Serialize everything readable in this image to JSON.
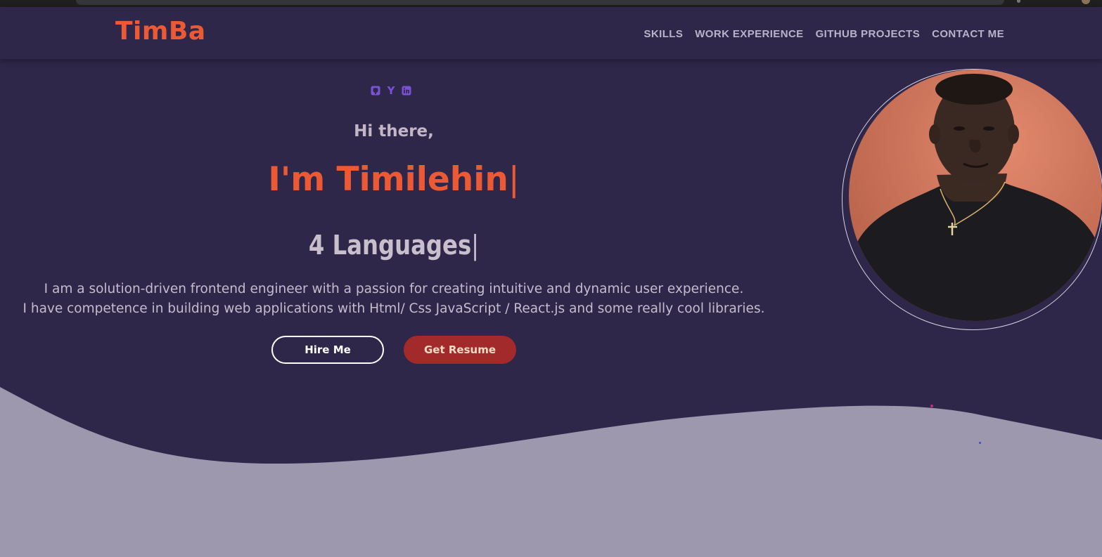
{
  "brand": "TimBa",
  "nav": {
    "items": [
      "SKILLS",
      "WORK EXPERIENCE",
      "GITHUB PROJECTS",
      "CONTACT ME"
    ]
  },
  "socials": [
    {
      "icon": "github-icon"
    },
    {
      "icon": "ycombinator-icon",
      "glyph": "Y"
    },
    {
      "icon": "linkedin-icon"
    }
  ],
  "hero": {
    "greeting": "Hi there,",
    "name": "I'm Timilehin",
    "typed": "4 Languages",
    "cursor": "|",
    "intro_line1": "I am a solution-driven frontend engineer with a passion for creating intuitive and dynamic user experience.",
    "intro_line2": "I have competence in building web applications with Html/ Css JavaScript / React.js and some really cool libraries."
  },
  "buttons": {
    "hire": "Hire Me",
    "resume": "Get Resume"
  },
  "colors": {
    "background": "#2f2749",
    "accent": "#ec5a35",
    "wave": "#9e98ae",
    "resume_button": "#a32a2a",
    "social_icon": "#7a52d8"
  }
}
